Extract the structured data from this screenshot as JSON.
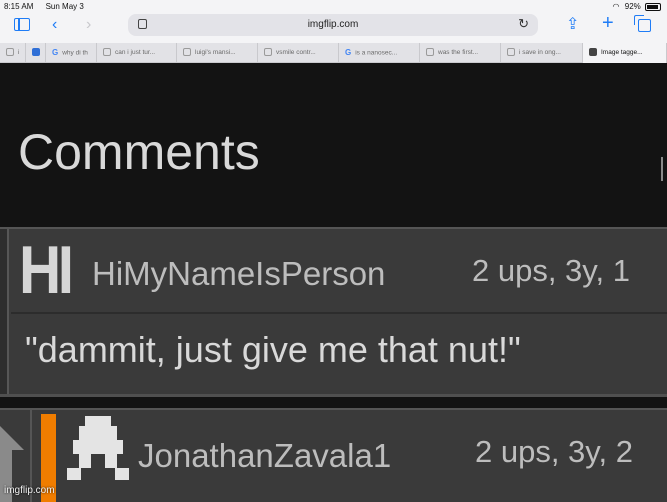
{
  "status_bar": {
    "time": "8:15 AM",
    "date": "Sun May 3",
    "battery": "92%"
  },
  "toolbar": {
    "url": "imgflip.com"
  },
  "tabs": [
    {
      "label": "i",
      "favicon": "gray"
    },
    {
      "label": "why di th",
      "favicon": "google"
    },
    {
      "label": "can i just tur...",
      "favicon": "gray"
    },
    {
      "label": "luigi's mansi...",
      "favicon": "gray"
    },
    {
      "label": "vsmile contr...",
      "favicon": "gray"
    },
    {
      "label": "is a nanosec...",
      "favicon": "google"
    },
    {
      "label": "was the first...",
      "favicon": "gray"
    },
    {
      "label": "i save in ong...",
      "favicon": "gray"
    },
    {
      "label": "Image tagge...",
      "favicon": "dark"
    }
  ],
  "page": {
    "title": "Comments",
    "comments": [
      {
        "avatar_text": "HI",
        "username": "HiMyNameIsPerson",
        "meta": "2 ups, 3y, 1",
        "text": "\"dammit, just give me that nut!\""
      },
      {
        "username": "JonathanZavala1",
        "meta": "2 ups, 3y, 2"
      }
    ]
  },
  "watermark": "imgflip.com",
  "colors": {
    "accent": "#1f7cf6",
    "orange_bar": "#f07d00",
    "comment_bg": "#3a3a3a",
    "page_bg": "#131313"
  }
}
